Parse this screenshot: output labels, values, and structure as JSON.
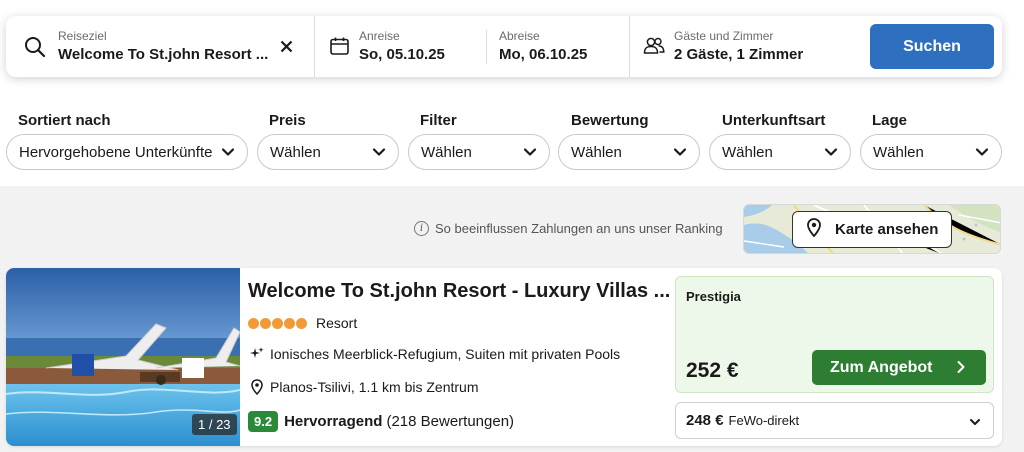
{
  "search": {
    "destination_label": "Reiseziel",
    "destination_value": "Welcome To St.john Resort ...",
    "checkin_label": "Anreise",
    "checkin_value": "So, 05.10.25",
    "checkout_label": "Abreise",
    "checkout_value": "Mo, 06.10.25",
    "guests_label": "Gäste und Zimmer",
    "guests_value": "2 Gäste, 1 Zimmer",
    "button_label": "Suchen",
    "icons": {
      "search": "search-icon",
      "clear": "close-icon",
      "calendar": "calendar-icon",
      "guests": "guests-icon"
    }
  },
  "filters": [
    {
      "label": "Sortiert nach",
      "value": "Hervorgehobene Unterkünfte"
    },
    {
      "label": "Preis",
      "value": "Wählen"
    },
    {
      "label": "Filter",
      "value": "Wählen"
    },
    {
      "label": "Bewertung",
      "value": "Wählen"
    },
    {
      "label": "Unterkunftsart",
      "value": "Wählen"
    },
    {
      "label": "Lage",
      "value": "Wählen"
    }
  ],
  "ranking_info": "So beeinflussen Zahlungen an uns unser Ranking",
  "map": {
    "button_label": "Karte ansehen"
  },
  "result": {
    "title": "Welcome To St.john Resort - Luxury Villas ...",
    "star_count": 5,
    "type": "Resort",
    "features": [
      {
        "icon": "sparkle-icon",
        "text": "Ionisches Meerblick-Refugium, Suiten mit privaten Pools"
      },
      {
        "icon": "location-pin-icon",
        "text": "Planos-Tsilivi, 1.1 km bis Zentrum"
      }
    ],
    "photo_count": "1 / 23",
    "rating": {
      "score": "9.2",
      "word": "Hervorragend",
      "reviews": "(218 Bewertungen)"
    },
    "deal": {
      "provider": "Prestigia",
      "price": "252 €",
      "button_label": "Zum Angebot"
    },
    "alt_deal": {
      "price": "248 €",
      "provider": "FeWo-direkt"
    }
  },
  "colors": {
    "search_button": "#2f6fbf",
    "offer_button": "#2d7d32",
    "score_badge": "#2a8a3a",
    "star_dots": "#f29a38",
    "deal_background": "#eef8ea"
  }
}
